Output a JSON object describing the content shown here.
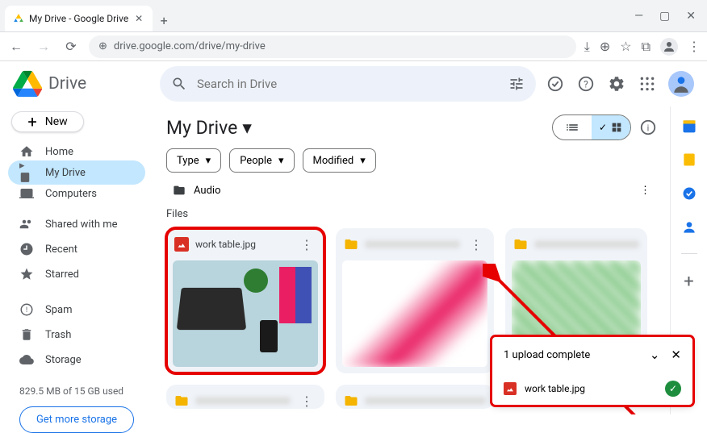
{
  "browser": {
    "tab_title": "My Drive - Google Drive",
    "url": "drive.google.com/drive/my-drive"
  },
  "app": {
    "name": "Drive",
    "search_placeholder": "Search in Drive"
  },
  "sidebar": {
    "new_label": "New",
    "items": [
      {
        "label": "Home"
      },
      {
        "label": "My Drive"
      },
      {
        "label": "Computers"
      },
      {
        "label": "Shared with me"
      },
      {
        "label": "Recent"
      },
      {
        "label": "Starred"
      },
      {
        "label": "Spam"
      },
      {
        "label": "Trash"
      },
      {
        "label": "Storage"
      }
    ],
    "storage_text": "829.5 MB of 15 GB used",
    "get_storage": "Get more storage"
  },
  "content": {
    "breadcrumb": "My Drive",
    "filters": [
      {
        "label": "Type"
      },
      {
        "label": "People"
      },
      {
        "label": "Modified"
      }
    ],
    "folder_row_label": "Audio",
    "files_label": "Files",
    "files": [
      {
        "name": "work table.jpg",
        "type": "image"
      },
      {
        "name": "",
        "type": "folder"
      },
      {
        "name": "",
        "type": "folder"
      }
    ]
  },
  "upload": {
    "status": "1 upload complete",
    "file": "work table.jpg"
  }
}
